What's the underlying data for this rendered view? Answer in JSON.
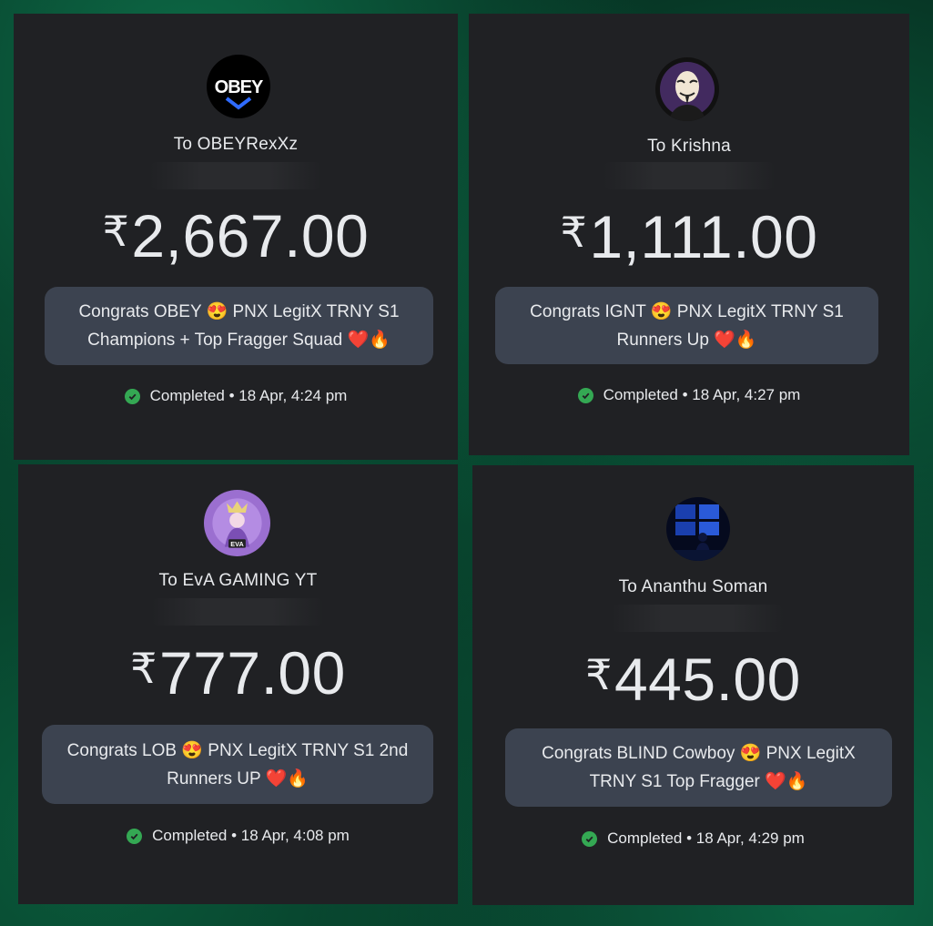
{
  "currency_symbol": "₹",
  "status_icon": "check-circle-icon",
  "colors": {
    "card_background": "#202124",
    "note_background": "#3c4350",
    "completed_green": "#34a853",
    "backdrop_green": "#0a5a3b"
  },
  "payments": [
    {
      "recipient": "To OBEYRexXz",
      "amount": "2,667.00",
      "note": "Congrats OBEY 😍 PNX LegitX TRNY S1 Champions + Top Fragger Squad ❤️🔥",
      "status": "Completed • 18 Apr, 4:24 pm",
      "avatar_icon": "obey-logo-avatar"
    },
    {
      "recipient": "To Krishna",
      "amount": "1,111.00",
      "note": "Congrats IGNT 😍 PNX LegitX TRNY S1 Runners Up ❤️🔥",
      "status": "Completed • 18 Apr, 4:27 pm",
      "avatar_icon": "masked-face-avatar"
    },
    {
      "recipient": "To EvA GAMING YT",
      "amount": "777.00",
      "note": "Congrats LOB 😍 PNX LegitX TRNY S1 2nd Runners UP ❤️🔥",
      "status": "Completed • 18 Apr, 4:08 pm",
      "avatar_icon": "eva-gaming-avatar"
    },
    {
      "recipient": "To Ananthu Soman",
      "amount": "445.00",
      "note": "Congrats BLIND Cowboy 😍 PNX LegitX TRNY S1 Top Fragger ❤️🔥",
      "status": "Completed • 18 Apr, 4:29 pm",
      "avatar_icon": "night-room-avatar"
    }
  ]
}
